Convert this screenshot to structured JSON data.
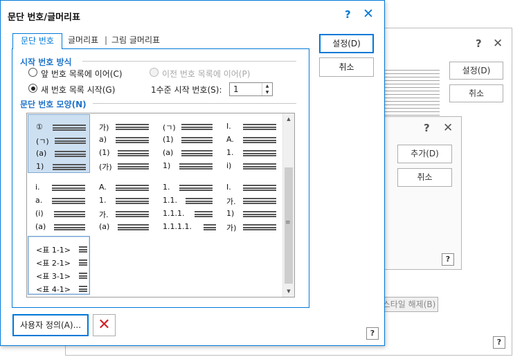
{
  "background": {
    "dialog1": {
      "help_q": "?",
      "close": "✕",
      "set_button": "설정(D)",
      "cancel_button": "취소",
      "style_reset_button": "스타일 해제(B)",
      "help": "?"
    },
    "dialog2": {
      "help_q": "?",
      "close": "✕",
      "add_button": "추가(D)",
      "cancel_button": "취소",
      "help": "?"
    }
  },
  "dialog": {
    "title": "문단 번호/글머리표",
    "help_q": "?",
    "close": "✕",
    "tabs": [
      "문단 번호",
      "글머리표",
      "그림 글머리표"
    ],
    "tab_separator": "|",
    "sections": {
      "method": "시작 번호 방식",
      "shape": "문단 번호 모양(N)"
    },
    "radios": {
      "continue_prev": "앞 번호 목록에 이어(C)",
      "continue_before": "이전 번호 목록에 이어(P)",
      "new_start": "새 번호 목록 시작(G)"
    },
    "level_start_label": "1수준 시작 번호(S):",
    "level_start_value": "1",
    "buttons": {
      "set": "설정(D)",
      "cancel": "취소",
      "custom": "사용자 정의(A)...",
      "delete": "✕",
      "help": "?"
    },
    "styles": [
      [
        "①",
        "(ㄱ)",
        "(a)",
        "1)"
      ],
      [
        "가)",
        "a)",
        "(1)",
        "(가)"
      ],
      [
        "(ㄱ)",
        "(1)",
        "(a)",
        "1)"
      ],
      [
        "I.",
        "A.",
        "1.",
        "i)"
      ],
      [
        "i.",
        "a.",
        "(i)",
        "(a)"
      ],
      [
        "A.",
        "1.",
        "가.",
        "(a)"
      ],
      [
        "1.",
        "1.1.",
        "1.1.1.",
        "1.1.1.1."
      ],
      [
        "I.",
        "가.",
        "1)",
        "가)"
      ],
      [
        "<표 1-1>",
        "<표 2-1>",
        "<표 3-1>",
        "<표 4-1>"
      ]
    ]
  }
}
